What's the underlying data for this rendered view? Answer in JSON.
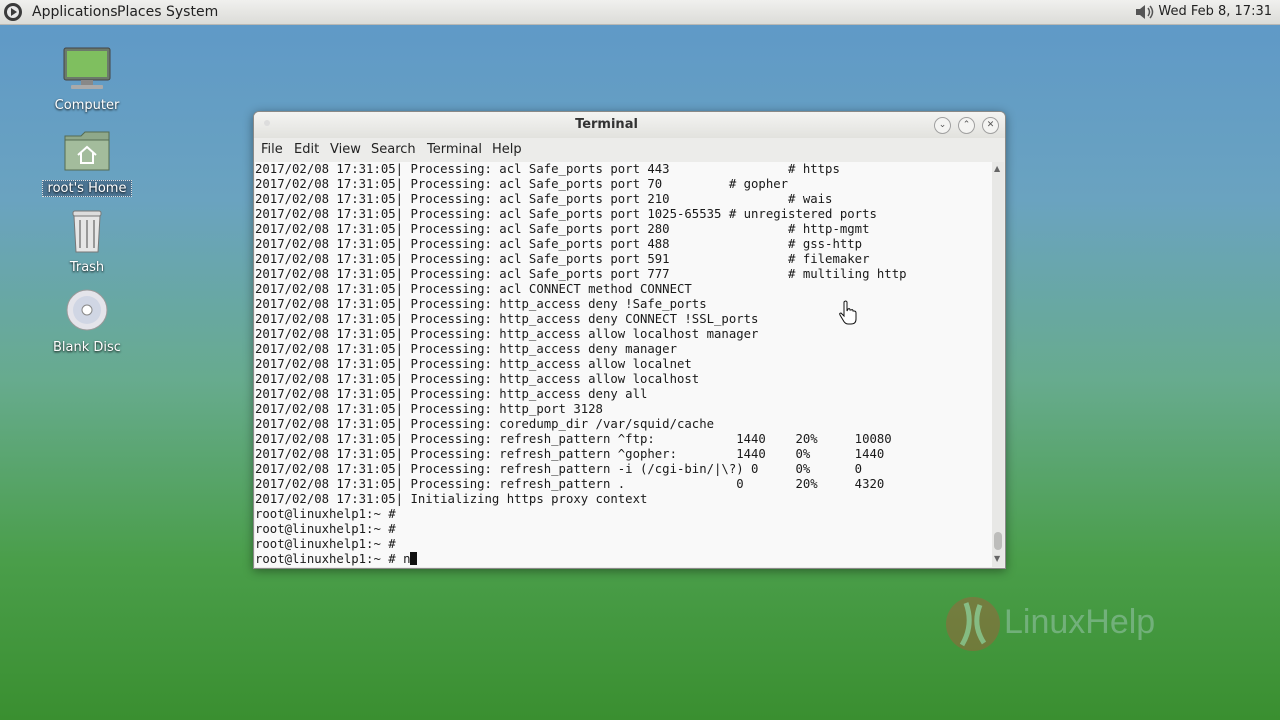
{
  "top_panel": {
    "menus": [
      "Applications",
      "Places",
      "System"
    ],
    "clock": "Wed Feb  8, 17:31"
  },
  "desktop": {
    "icons": [
      {
        "label": "Computer"
      },
      {
        "label": "root's Home"
      },
      {
        "label": "Trash"
      },
      {
        "label": "Blank Disc"
      }
    ]
  },
  "terminal": {
    "title": "Terminal",
    "menu": [
      "File",
      "Edit",
      "View",
      "Search",
      "Terminal",
      "Help"
    ],
    "lines": [
      "2017/02/08 17:31:05| Processing: acl Safe_ports port 443                # https",
      "2017/02/08 17:31:05| Processing: acl Safe_ports port 70         # gopher",
      "2017/02/08 17:31:05| Processing: acl Safe_ports port 210                # wais",
      "2017/02/08 17:31:05| Processing: acl Safe_ports port 1025-65535 # unregistered ports",
      "2017/02/08 17:31:05| Processing: acl Safe_ports port 280                # http-mgmt",
      "2017/02/08 17:31:05| Processing: acl Safe_ports port 488                # gss-http",
      "2017/02/08 17:31:05| Processing: acl Safe_ports port 591                # filemaker",
      "2017/02/08 17:31:05| Processing: acl Safe_ports port 777                # multiling http",
      "2017/02/08 17:31:05| Processing: acl CONNECT method CONNECT",
      "2017/02/08 17:31:05| Processing: http_access deny !Safe_ports",
      "2017/02/08 17:31:05| Processing: http_access deny CONNECT !SSL_ports",
      "2017/02/08 17:31:05| Processing: http_access allow localhost manager",
      "2017/02/08 17:31:05| Processing: http_access deny manager",
      "2017/02/08 17:31:05| Processing: http_access allow localnet",
      "2017/02/08 17:31:05| Processing: http_access allow localhost",
      "2017/02/08 17:31:05| Processing: http_access deny all",
      "2017/02/08 17:31:05| Processing: http_port 3128",
      "2017/02/08 17:31:05| Processing: coredump_dir /var/squid/cache",
      "2017/02/08 17:31:05| Processing: refresh_pattern ^ftp:           1440    20%     10080",
      "2017/02/08 17:31:05| Processing: refresh_pattern ^gopher:        1440    0%      1440",
      "2017/02/08 17:31:05| Processing: refresh_pattern -i (/cgi-bin/|\\?) 0     0%      0",
      "2017/02/08 17:31:05| Processing: refresh_pattern .               0       20%     4320",
      "2017/02/08 17:31:05| Initializing https proxy context",
      "root@linuxhelp1:~ #",
      "root@linuxhelp1:~ #",
      "root@linuxhelp1:~ #"
    ],
    "prompt_line": "root@linuxhelp1:~ # n"
  },
  "watermark": "LinuxHelp"
}
